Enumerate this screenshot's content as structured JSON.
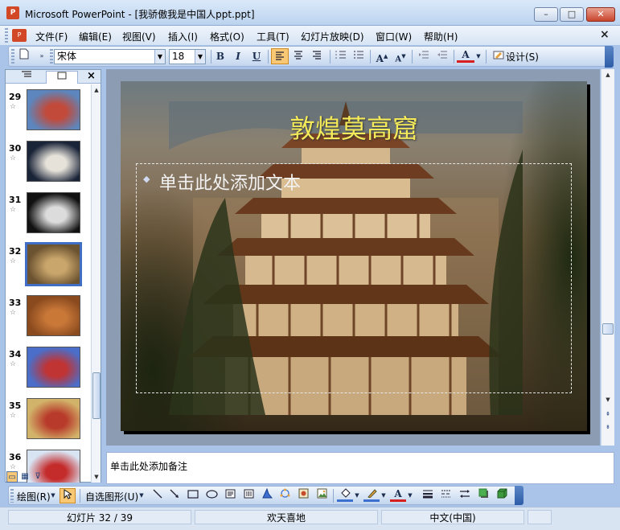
{
  "window": {
    "title": "Microsoft PowerPoint - [我骄傲我是中国人ppt.ppt]",
    "app_icon": "P",
    "minimize_icon": "–",
    "maximize_icon": "□",
    "close_icon": "✕"
  },
  "menubar": {
    "items": [
      "文件(F)",
      "编辑(E)",
      "视图(V)",
      "插入(I)",
      "格式(O)",
      "工具(T)",
      "幻灯片放映(D)",
      "窗口(W)",
      "帮助(H)"
    ],
    "close_icon": "×"
  },
  "toolbar": {
    "font_name": "宋体",
    "font_size": "18",
    "bold": "B",
    "italic": "I",
    "underline": "U",
    "grow_font": "A",
    "shrink_font": "A",
    "font_color": "A",
    "design_label": "设计(S)"
  },
  "left_panel": {
    "tabs": [
      "outline-tab",
      "slides-tab"
    ],
    "close_icon": "×",
    "slides": [
      {
        "number": "29",
        "star": "☆",
        "thumb_colors": [
          "#5c86bd",
          "#c24a3a"
        ]
      },
      {
        "number": "30",
        "star": "☆",
        "thumb_colors": [
          "#1a2438",
          "#e6e2da"
        ]
      },
      {
        "number": "31",
        "star": "☆",
        "thumb_colors": [
          "#111111",
          "#dcdcdc"
        ]
      },
      {
        "number": "32",
        "star": "☆",
        "thumb_colors": [
          "#6b5230",
          "#c9a66b"
        ],
        "selected": true
      },
      {
        "number": "33",
        "star": "☆",
        "thumb_colors": [
          "#8a4a1e",
          "#c97838"
        ]
      },
      {
        "number": "34",
        "star": "☆",
        "thumb_colors": [
          "#4a6ec9",
          "#c03434"
        ]
      },
      {
        "number": "35",
        "star": "☆",
        "thumb_colors": [
          "#d2b36a",
          "#b83a2a"
        ]
      },
      {
        "number": "36",
        "star": "☆",
        "thumb_colors": [
          "#d9e4f3",
          "#c42c2c"
        ]
      }
    ]
  },
  "slide": {
    "title": "敦煌莫高窟",
    "body_placeholder": "单击此处添加文本",
    "bullet": "◆",
    "title_color": "#f4ea5a"
  },
  "notes": {
    "placeholder": "单击此处添加备注"
  },
  "drawing_toolbar": {
    "draw_label": "绘图(R)",
    "autoshapes_label": "自选图形(U)"
  },
  "status_bar": {
    "slide_position": "幻灯片 32 / 39",
    "design_template": "欢天喜地",
    "language": "中文(中国)"
  }
}
